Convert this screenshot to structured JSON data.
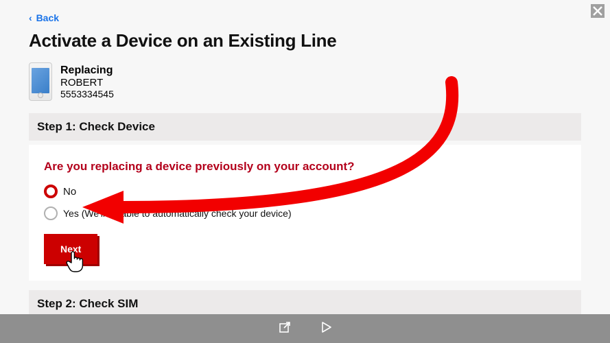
{
  "nav": {
    "back_label": "Back"
  },
  "title": "Activate a Device on an Existing Line",
  "replacing": {
    "label": "Replacing",
    "name": "ROBERT",
    "phone": "5553334545"
  },
  "step1": {
    "heading": "Step 1: Check Device",
    "question": "Are you replacing a device previously on your account?",
    "option_no": "No",
    "option_yes": "Yes (We'll be able to automatically check your device)",
    "next_label": "Next"
  },
  "step2": {
    "heading": "Step 2: Check SIM"
  },
  "colors": {
    "accent": "#cc0000",
    "link": "#1a73e8",
    "question": "#b3001b"
  }
}
